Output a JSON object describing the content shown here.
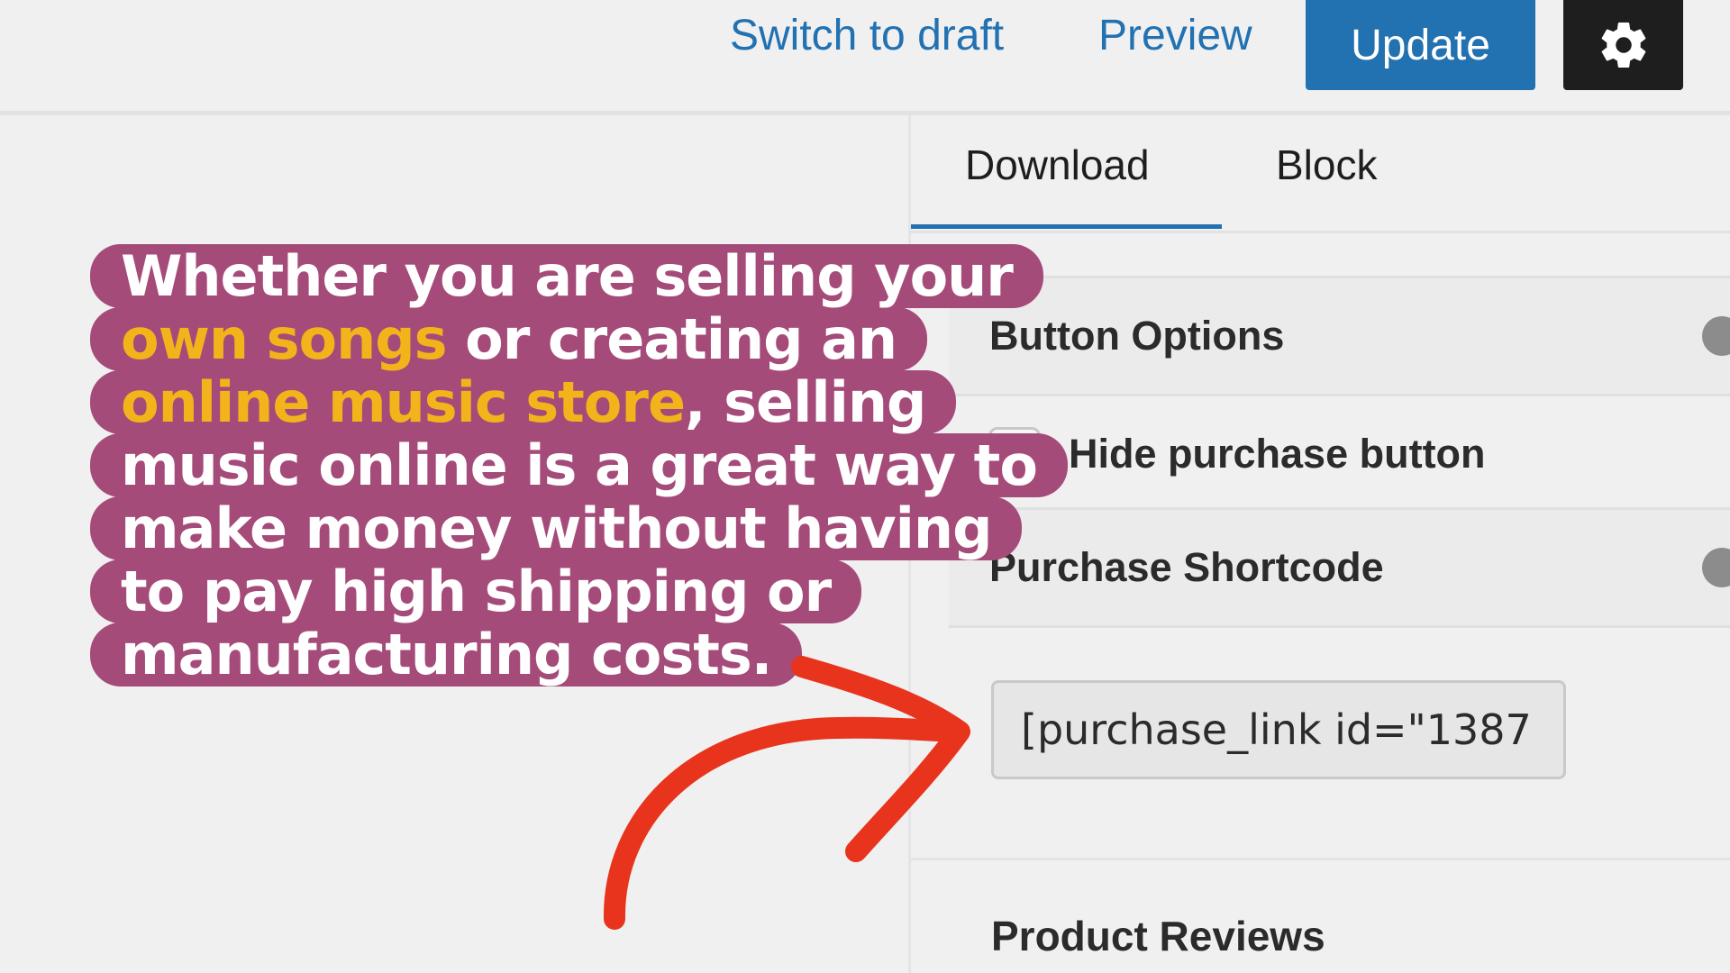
{
  "toolbar": {
    "switch_to_draft": "Switch to draft",
    "preview": "Preview",
    "update": "Update",
    "settings_icon": "gear-icon"
  },
  "sidebar": {
    "tabs": [
      {
        "label": "Download",
        "active": true
      },
      {
        "label": "Block",
        "active": false
      }
    ],
    "button_options": {
      "title": "Button Options",
      "hide_purchase_button": {
        "label": "Hide purchase button",
        "checked": false
      }
    },
    "purchase_shortcode": {
      "title": "Purchase Shortcode",
      "value": "[purchase_link id=\"1387"
    },
    "product_reviews": {
      "title": "Product Reviews"
    }
  },
  "overlay_caption": {
    "lines": [
      [
        {
          "text": "Whether you are selling your",
          "highlight": false
        }
      ],
      [
        {
          "text": "own songs",
          "highlight": true
        },
        {
          "text": " or creating an",
          "highlight": false
        }
      ],
      [
        {
          "text": "online music store",
          "highlight": true
        },
        {
          "text": ", selling",
          "highlight": false
        }
      ],
      [
        {
          "text": "music online is a great way to",
          "highlight": false
        }
      ],
      [
        {
          "text": "make money without having",
          "highlight": false
        }
      ],
      [
        {
          "text": "to pay high shipping or",
          "highlight": false
        }
      ],
      [
        {
          "text": "manufacturing costs.",
          "highlight": false
        }
      ]
    ],
    "colors": {
      "background": "#a54b79",
      "text": "#ffffff",
      "highlight": "#f3b41b"
    }
  },
  "colors": {
    "accent": "#2271b1",
    "arrow": "#e8341c",
    "dark_button": "#1e1e1e"
  }
}
